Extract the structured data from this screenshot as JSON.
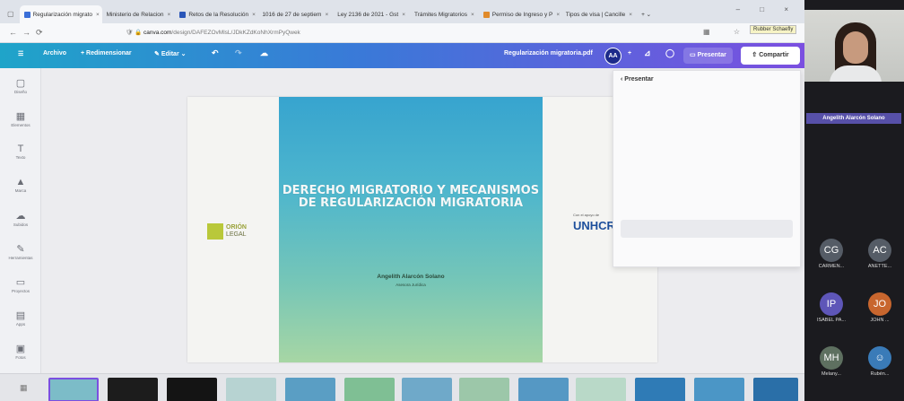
{
  "browser": {
    "tabs": [
      {
        "label": "Regularización migrato",
        "active": true
      },
      {
        "label": "Ministerio de Relacion"
      },
      {
        "label": "Retos de la Resolución"
      },
      {
        "label": "1016 de 27 de septiem"
      },
      {
        "label": "Ley 2136 de 2021 - Gst"
      },
      {
        "label": "Trámites Migratorios"
      },
      {
        "label": "Permiso de Ingreso y P"
      },
      {
        "label": "Tipos de visa | Cancille"
      }
    ],
    "url_domain": "canva.com",
    "url_path": "/design/DAFEZOvMlsL/JDkKZdKoNhXrmPyQwek",
    "tooltip": "Rubber Schaefly"
  },
  "canva": {
    "menu": [
      "Archivo",
      "Redimensionar"
    ],
    "edit_label": "Editar",
    "file_name": "Regularización migratoria.pdf",
    "avatar_initials": "AA",
    "present_label": "Presentar",
    "share_label": "Compartir"
  },
  "sidebar": [
    {
      "icon": "▢",
      "label": "Diseño"
    },
    {
      "icon": "▦",
      "label": "Elementos"
    },
    {
      "icon": "T",
      "label": "Texto"
    },
    {
      "icon": "▲",
      "label": "Marca"
    },
    {
      "icon": "☁",
      "label": "Subidos"
    },
    {
      "icon": "✎",
      "label": "Herramientas"
    },
    {
      "icon": "▭",
      "label": "Proyectos"
    },
    {
      "icon": "▤",
      "label": "Apps"
    },
    {
      "icon": "▣",
      "label": "Fotos"
    }
  ],
  "slide": {
    "title": "DERECHO MIGRATORIO Y MECANISMOS DE REGULARIZACIÓN MIGRATORIA",
    "author": "Angelith Alarcón Solano",
    "role": "Asesora Jurídica",
    "left_logo_line1": "ORIÓN",
    "left_logo_line2": "LEGAL",
    "right_logo_small": "Con el apoyo de",
    "right_logo_text": "UNHCR"
  },
  "present_panel": {
    "title": "Presentar"
  },
  "meeting": {
    "speaker_name": "Angelith Alarcón Solano",
    "participants": [
      {
        "initials": "CG",
        "name": "CARMEN...",
        "color": "#555c66"
      },
      {
        "initials": "AC",
        "name": "ANETTE...",
        "color": "#555c66"
      },
      {
        "initials": "IP",
        "name": "ISABEL PA...",
        "color": "#5e56b8"
      },
      {
        "initials": "JO",
        "name": "JOHN ...",
        "color": "#c8662e"
      },
      {
        "initials": "MH",
        "name": "Melany...",
        "color": "#5e7060"
      },
      {
        "initials": "",
        "name": "Rubén...",
        "color": "#3a7bb8"
      }
    ]
  }
}
